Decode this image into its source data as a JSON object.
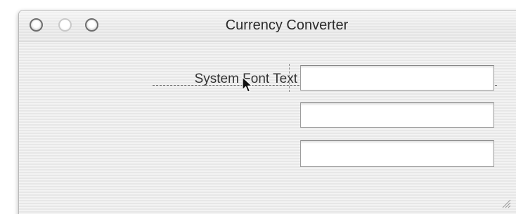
{
  "window": {
    "title": "Currency Converter",
    "buttons": [
      "close-button",
      "minimize-button",
      "zoom-button"
    ]
  },
  "content": {
    "label_text": "System Font Text",
    "fields": [
      {
        "value": "",
        "placeholder": ""
      },
      {
        "value": "",
        "placeholder": ""
      },
      {
        "value": "",
        "placeholder": ""
      }
    ]
  },
  "icons": {
    "cursor": "arrow-cursor-icon",
    "resize": "resize-grip-icon"
  }
}
